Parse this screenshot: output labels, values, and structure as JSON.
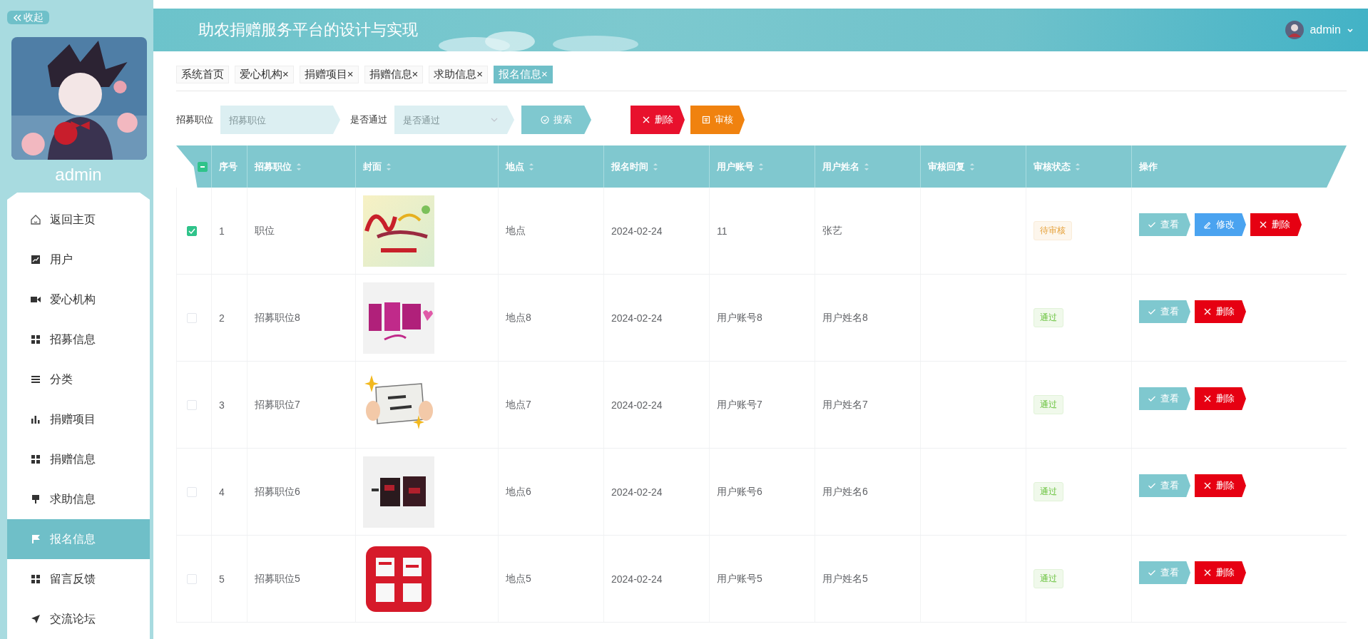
{
  "sidebar": {
    "collapse_button": "收起",
    "user_name": "admin",
    "menu": [
      {
        "label": "返回主页",
        "kind": "home",
        "selected": false
      },
      {
        "label": "用户",
        "kind": "chart",
        "selected": false
      },
      {
        "label": "爱心机构",
        "kind": "camera",
        "selected": false
      },
      {
        "label": "招募信息",
        "kind": "grid",
        "selected": false
      },
      {
        "label": "分类",
        "kind": "list",
        "selected": false
      },
      {
        "label": "捐赠项目",
        "kind": "bars",
        "selected": false
      },
      {
        "label": "捐赠信息",
        "kind": "grid",
        "selected": false
      },
      {
        "label": "求助信息",
        "kind": "pin",
        "selected": false
      },
      {
        "label": "报名信息",
        "kind": "flag",
        "selected": true
      },
      {
        "label": "留言反馈",
        "kind": "grid",
        "selected": false
      },
      {
        "label": "交流论坛",
        "kind": "send",
        "selected": false
      }
    ]
  },
  "header": {
    "title": "助农捐赠服务平台的设计与实现",
    "user": "admin"
  },
  "tabs": [
    {
      "label": "系统首页",
      "selected": false
    },
    {
      "label": "爱心机构",
      "close_mark": "×",
      "selected": false
    },
    {
      "label": "捐赠项目",
      "close_mark": "×",
      "selected": false
    },
    {
      "label": "捐赠信息",
      "close_mark": "×",
      "selected": false
    },
    {
      "label": "求助信息",
      "close_mark": "×",
      "selected": false
    },
    {
      "label": "报名信息",
      "close_mark": "×",
      "selected": true
    }
  ],
  "search": {
    "fields": [
      {
        "label": "招募职位",
        "placeholder": "招募职位",
        "kind": "input"
      },
      {
        "label": "是否通过",
        "placeholder": "是否通过",
        "kind": "select"
      }
    ],
    "buttons": [
      {
        "label": "搜索",
        "kind": "search"
      },
      {
        "label": "删除",
        "kind": "delete"
      },
      {
        "label": "审核",
        "kind": "review"
      }
    ]
  },
  "table": {
    "some_selected": true,
    "columns": [
      {
        "label": "序号",
        "sortable": false
      },
      {
        "label": "招募职位",
        "sortable": true
      },
      {
        "label": "封面",
        "sortable": true
      },
      {
        "label": "地点",
        "sortable": true
      },
      {
        "label": "报名时间",
        "sortable": true
      },
      {
        "label": "用户账号",
        "sortable": true
      },
      {
        "label": "用户姓名",
        "sortable": true
      },
      {
        "label": "审核回复",
        "sortable": true
      },
      {
        "label": "审核状态",
        "sortable": true
      },
      {
        "label": "操作",
        "sortable": false
      }
    ],
    "rows": [
      {
        "selected": true,
        "index": "1",
        "position": "职位",
        "cover": {
          "kind": "picture"
        },
        "location": "地点",
        "time": "2024-02-24",
        "account": "11",
        "name": "张艺",
        "status": {
          "label": "待审核",
          "kind": "pending"
        },
        "actions": [
          {
            "label": "查看",
            "kind": "view"
          },
          {
            "label": "修改",
            "kind": "edit"
          },
          {
            "label": "删除",
            "kind": "delete"
          }
        ]
      },
      {
        "selected": false,
        "index": "2",
        "position": "招募职位8",
        "cover": {
          "kind": "picture"
        },
        "location": "地点8",
        "time": "2024-02-24",
        "account": "用户账号8",
        "name": "用户姓名8",
        "status": {
          "label": "通过",
          "kind": "pass"
        },
        "actions": [
          {
            "label": "查看",
            "kind": "view"
          },
          {
            "label": "删除",
            "kind": "delete"
          }
        ]
      },
      {
        "selected": false,
        "index": "3",
        "position": "招募职位7",
        "cover": {
          "kind": "picture"
        },
        "location": "地点7",
        "time": "2024-02-24",
        "account": "用户账号7",
        "name": "用户姓名7",
        "status": {
          "label": "通过",
          "kind": "pass"
        },
        "actions": [
          {
            "label": "查看",
            "kind": "view"
          },
          {
            "label": "删除",
            "kind": "delete"
          }
        ]
      },
      {
        "selected": false,
        "index": "4",
        "position": "招募职位6",
        "cover": {
          "kind": "picture"
        },
        "location": "地点6",
        "time": "2024-02-24",
        "account": "用户账号6",
        "name": "用户姓名6",
        "status": {
          "label": "通过",
          "kind": "pass"
        },
        "actions": [
          {
            "label": "查看",
            "kind": "view"
          },
          {
            "label": "删除",
            "kind": "delete"
          }
        ]
      },
      {
        "selected": false,
        "index": "5",
        "position": "招募职位5",
        "cover": {
          "kind": "picture"
        },
        "location": "地点5",
        "time": "2024-02-24",
        "account": "用户账号5",
        "name": "用户姓名5",
        "status": {
          "label": "通过",
          "kind": "pass"
        },
        "actions": [
          {
            "label": "查看",
            "kind": "view"
          },
          {
            "label": "删除",
            "kind": "delete"
          }
        ]
      }
    ]
  }
}
